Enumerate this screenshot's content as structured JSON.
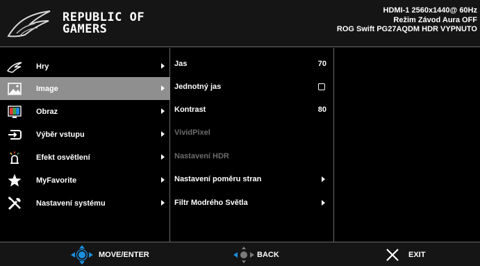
{
  "header": {
    "logo_line1": "REPUBLIC OF",
    "logo_line2": "GAMERS",
    "status": {
      "input_line": "HDMI-1  2560x1440@  60Hz",
      "mode_line": "Režim Závod   Aura OFF",
      "model_line": "ROG Swift  PG27AQDM  HDR VYPNUTO"
    }
  },
  "main_menu": [
    {
      "label": "Hry",
      "icon": "rog-eye-icon",
      "selected": false
    },
    {
      "label": "Image",
      "icon": "image-icon",
      "selected": true
    },
    {
      "label": "Obraz",
      "icon": "color-bars-icon",
      "selected": false
    },
    {
      "label": "Výběr vstupu",
      "icon": "input-source-icon",
      "selected": false
    },
    {
      "label": "Efekt osvětlení",
      "icon": "lighting-effect-icon",
      "selected": false
    },
    {
      "label": "MyFavorite",
      "icon": "star-icon",
      "selected": false
    },
    {
      "label": "Nastavení systému",
      "icon": "wrench-screwdriver-icon",
      "selected": false
    }
  ],
  "sub_menu": [
    {
      "label": "Jas",
      "value": "70",
      "enabled": true,
      "kind": "value"
    },
    {
      "label": "Jednotný jas",
      "value": "",
      "enabled": true,
      "kind": "toggle"
    },
    {
      "label": "Kontrast",
      "value": "80",
      "enabled": true,
      "kind": "value"
    },
    {
      "label": "VividPixel",
      "value": "",
      "enabled": false,
      "kind": "none"
    },
    {
      "label": "Nastavení HDR",
      "value": "",
      "enabled": false,
      "kind": "none"
    },
    {
      "label": "Nastavení poměru stran",
      "value": "",
      "enabled": true,
      "kind": "arrow"
    },
    {
      "label": "Filtr Modrého Světla",
      "value": "",
      "enabled": true,
      "kind": "arrow"
    }
  ],
  "footer": {
    "move_label": "MOVE/ENTER",
    "back_label": "BACK",
    "exit_label": "EXIT"
  },
  "colors": {
    "header_bg": "#151515",
    "selected_bg": "#8f8f8f",
    "disabled_text": "#6c6c6c",
    "nav_blue": "#1a8fe0",
    "divider": "#6a6a6a"
  }
}
